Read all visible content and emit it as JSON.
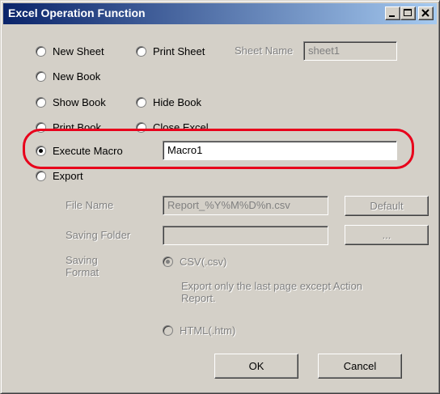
{
  "window": {
    "title": "Excel Operation Function"
  },
  "options": {
    "new_sheet": "New Sheet",
    "print_sheet": "Print Sheet",
    "new_book": "New Book",
    "show_book": "Show Book",
    "hide_book": "Hide Book",
    "print_book": "Print Book",
    "close_excel": "Close Excel",
    "execute_macro": "Execute Macro",
    "export": "Export"
  },
  "sheet_name": {
    "label": "Sheet Name",
    "value": "sheet1"
  },
  "macro": {
    "value": "Macro1"
  },
  "export": {
    "file_name_label": "File Name",
    "file_name_value": "Report_%Y%M%D%n.csv",
    "default_button": "Default",
    "saving_folder_label": "Saving Folder",
    "saving_folder_value": "",
    "browse_button": "...",
    "saving_format_label_line1": "Saving",
    "saving_format_label_line2": "Format",
    "csv_option": "CSV(.csv)",
    "csv_note_line1": "Export only the last page except Action",
    "csv_note_line2": "Report.",
    "html_option": "HTML(.htm)"
  },
  "buttons": {
    "ok": "OK",
    "cancel": "Cancel"
  },
  "colors": {
    "highlight": "#e8001b",
    "titlebar_start": "#0a246a",
    "titlebar_end": "#a6caf0"
  }
}
